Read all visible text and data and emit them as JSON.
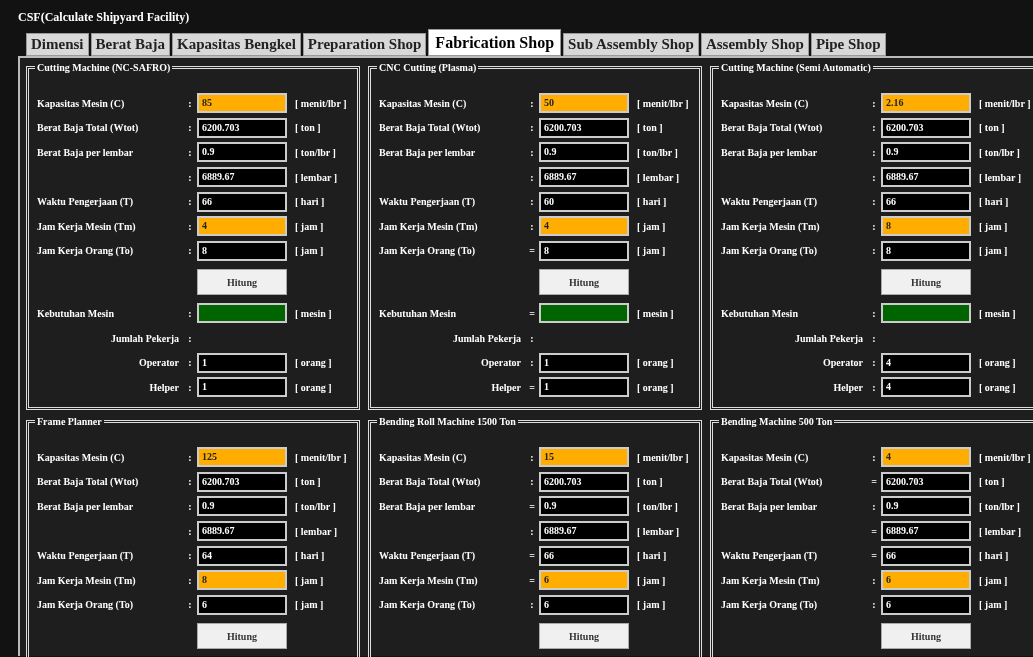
{
  "window": {
    "title": "CSF(Calculate Shipyard Facility)"
  },
  "tabs": [
    {
      "label": "Dimensi",
      "selected": false
    },
    {
      "label": "Berat Baja",
      "selected": false
    },
    {
      "label": "Kapasitas Bengkel",
      "selected": false
    },
    {
      "label": "Preparation Shop",
      "selected": false
    },
    {
      "label": "Fabrication Shop",
      "selected": true
    },
    {
      "label": "Sub Assembly Shop",
      "selected": false
    },
    {
      "label": "Assembly Shop",
      "selected": false
    },
    {
      "label": "Pipe Shop",
      "selected": false
    }
  ],
  "panels": [
    {
      "title": "Cutting Machine (NC-SAFRO)",
      "rows": [
        {
          "kind": "field",
          "label": "Kapasitas Mesin (C)",
          "separator": ":",
          "value": "85",
          "highlighted": true,
          "unit": "[ menit/lbr ]"
        },
        {
          "kind": "field",
          "label": "Berat Baja  Total (Wtot)",
          "separator": ":",
          "value": "6200.703",
          "highlighted": false,
          "unit": "[ ton ]"
        },
        {
          "kind": "field",
          "label": "Berat Baja per lembar",
          "separator": ":",
          "value": "0.9",
          "highlighted": false,
          "unit": "[ ton/lbr ]"
        },
        {
          "kind": "field",
          "separator": ":",
          "value": "6889.67",
          "highlighted": false,
          "unit": "[ lembar ]"
        },
        {
          "kind": "field",
          "label": "Waktu Pengerjaan (T)",
          "separator": ":",
          "value": "66",
          "highlighted": false,
          "unit": "[ hari ]"
        },
        {
          "kind": "field",
          "label": "Jam Kerja Mesin (Tm)",
          "separator": ":",
          "value": "4",
          "highlighted": true,
          "unit": "[ jam ]"
        },
        {
          "kind": "field",
          "label": "Jam Kerja Orang (To)",
          "separator": ":",
          "value": "8",
          "highlighted": false,
          "unit": "[ jam ]"
        },
        {
          "kind": "button",
          "label": "Hitung"
        },
        {
          "kind": "result",
          "label": "Kebutuhan Mesin",
          "separator": ":",
          "unit": "[ mesin ]"
        },
        {
          "kind": "group",
          "label": "Jumlah Pekerja",
          "separator": ":"
        },
        {
          "kind": "subfield",
          "label": "Operator",
          "separator": ":",
          "value": "1",
          "highlighted": false,
          "unit": "[ orang ]"
        },
        {
          "kind": "subfield",
          "label": "Helper",
          "separator": ":",
          "value": "1",
          "highlighted": false,
          "unit": "[ orang ]"
        }
      ]
    },
    {
      "title": "CNC Cutting (Plasma)",
      "rows": [
        {
          "kind": "field",
          "label": "Kapasitas Mesin (C)",
          "separator": ":",
          "value": "50",
          "highlighted": true,
          "unit": "[ menit/lbr ]"
        },
        {
          "kind": "field",
          "label": "Berat Baja  Total (Wtot)",
          "separator": ":",
          "value": "6200.703",
          "highlighted": false,
          "unit": "[ ton ]"
        },
        {
          "kind": "field",
          "label": "Berat Baja per lembar",
          "separator": ":",
          "value": "0.9",
          "highlighted": false,
          "unit": "[ ton/lbr ]"
        },
        {
          "kind": "field",
          "separator": ":",
          "value": "6889.67",
          "highlighted": false,
          "unit": "[ lembar ]"
        },
        {
          "kind": "field",
          "label": "Waktu Pengerjaan (T)",
          "separator": ":",
          "value": "60",
          "highlighted": false,
          "unit": "[ hari ]"
        },
        {
          "kind": "field",
          "label": "Jam Kerja Mesin (Tm)",
          "separator": ":",
          "value": "4",
          "highlighted": true,
          "unit": "[ jam ]"
        },
        {
          "kind": "field",
          "label": "Jam Kerja Orang (To)",
          "separator": "=",
          "value": "8",
          "highlighted": false,
          "unit": "[ jam ]"
        },
        {
          "kind": "button",
          "label": "Hitung"
        },
        {
          "kind": "result",
          "label": "Kebutuhan Mesin",
          "separator": "=",
          "unit": "[ mesin ]"
        },
        {
          "kind": "group",
          "label": "Jumlah Pekerja",
          "separator": ":"
        },
        {
          "kind": "subfield",
          "label": "Operator",
          "separator": ":",
          "value": "1",
          "highlighted": false,
          "unit": "[ orang ]"
        },
        {
          "kind": "subfield",
          "label": "Helper",
          "separator": "=",
          "value": "1",
          "highlighted": false,
          "unit": "[ orang ]"
        }
      ]
    },
    {
      "title": "Cutting Machine (Semi Automatic)",
      "rows": [
        {
          "kind": "field",
          "label": "Kapasitas Mesin (C)",
          "separator": ":",
          "value": "2.16",
          "highlighted": true,
          "unit": "[ menit/lbr ]"
        },
        {
          "kind": "field",
          "label": "Berat Baja  Total (Wtot)",
          "separator": ":",
          "value": "6200.703",
          "highlighted": false,
          "unit": "[ ton ]"
        },
        {
          "kind": "field",
          "label": "Berat Baja per lembar",
          "separator": ":",
          "value": "0.9",
          "highlighted": false,
          "unit": "[ ton/lbr ]"
        },
        {
          "kind": "field",
          "separator": ":",
          "value": "6889.67",
          "highlighted": false,
          "unit": "[ lembar ]"
        },
        {
          "kind": "field",
          "label": "Waktu Pengerjaan (T)",
          "separator": ":",
          "value": "66",
          "highlighted": false,
          "unit": "[ hari ]"
        },
        {
          "kind": "field",
          "label": "Jam Kerja Mesin (Tm)",
          "separator": ":",
          "value": "8",
          "highlighted": true,
          "unit": "[ jam ]"
        },
        {
          "kind": "field",
          "label": "Jam Kerja Orang (To)",
          "separator": ":",
          "value": "8",
          "highlighted": false,
          "unit": "[ jam ]"
        },
        {
          "kind": "button",
          "label": "Hitung"
        },
        {
          "kind": "result",
          "label": "Kebutuhan Mesin",
          "separator": ":",
          "unit": "[ mesin ]"
        },
        {
          "kind": "group",
          "label": "Jumlah Pekerja",
          "separator": ":"
        },
        {
          "kind": "subfield",
          "label": "Operator",
          "separator": ":",
          "value": "4",
          "highlighted": false,
          "unit": "[ orang ]"
        },
        {
          "kind": "subfield",
          "label": "Helper",
          "separator": ":",
          "value": "4",
          "highlighted": false,
          "unit": "[ orang ]"
        }
      ]
    },
    {
      "title": "Frame Planner",
      "rows": [
        {
          "kind": "field",
          "label": "Kapasitas Mesin (C)",
          "separator": ":",
          "value": "125",
          "highlighted": true,
          "unit": "[ menit/lbr ]"
        },
        {
          "kind": "field",
          "label": "Berat Baja  Total (Wtot)",
          "separator": ":",
          "value": "6200.703",
          "highlighted": false,
          "unit": "[ ton ]"
        },
        {
          "kind": "field",
          "label": "Berat Baja per lembar",
          "separator": ":",
          "value": "0.9",
          "highlighted": false,
          "unit": "[ ton/lbr ]"
        },
        {
          "kind": "field",
          "separator": ":",
          "value": "6889.67",
          "highlighted": false,
          "unit": "[ lembar ]"
        },
        {
          "kind": "field",
          "label": "Waktu Pengerjaan (T)",
          "separator": ":",
          "value": "64",
          "highlighted": false,
          "unit": "[ hari ]"
        },
        {
          "kind": "field",
          "label": "Jam Kerja Mesin (Tm)",
          "separator": ":",
          "value": "8",
          "highlighted": true,
          "unit": "[ jam ]"
        },
        {
          "kind": "field",
          "label": "Jam Kerja Orang (To)",
          "separator": ":",
          "value": "6",
          "highlighted": false,
          "unit": "[ jam ]"
        },
        {
          "kind": "button",
          "label": "Hitung"
        }
      ]
    },
    {
      "title": "Bending Roll Machine 1500 Ton",
      "rows": [
        {
          "kind": "field",
          "label": "Kapasitas Mesin (C)",
          "separator": ":",
          "value": "15",
          "highlighted": true,
          "unit": "[ menit/lbr ]"
        },
        {
          "kind": "field",
          "label": "Berat Baja  Total (Wtot)",
          "separator": ":",
          "value": "6200.703",
          "highlighted": false,
          "unit": "[ ton ]"
        },
        {
          "kind": "field",
          "label": "Berat Baja per lembar",
          "separator": "=",
          "value": "0.9",
          "highlighted": false,
          "unit": "[ ton/lbr ]"
        },
        {
          "kind": "field",
          "separator": ":",
          "value": "6889.67",
          "highlighted": false,
          "unit": "[ lembar ]"
        },
        {
          "kind": "field",
          "label": "Waktu Pengerjaan (T)",
          "separator": "=",
          "value": "66",
          "highlighted": false,
          "unit": "[ hari ]"
        },
        {
          "kind": "field",
          "label": "Jam Kerja Mesin (Tm)",
          "separator": "=",
          "value": "6",
          "highlighted": true,
          "unit": "[ jam ]"
        },
        {
          "kind": "field",
          "label": "Jam Kerja Orang (To)",
          "separator": ":",
          "value": "6",
          "highlighted": false,
          "unit": "[ jam ]"
        },
        {
          "kind": "button",
          "label": "Hitung"
        }
      ]
    },
    {
      "title": "Bending Machine 500 Ton",
      "rows": [
        {
          "kind": "field",
          "label": "Kapasitas Mesin (C)",
          "separator": ":",
          "value": "4",
          "highlighted": true,
          "unit": "[ menit/lbr ]"
        },
        {
          "kind": "field",
          "label": "Berat Baja  Total (Wtot)",
          "separator": "=",
          "value": "6200.703",
          "highlighted": false,
          "unit": "[ ton ]"
        },
        {
          "kind": "field",
          "label": "Berat Baja per lembar",
          "separator": ":",
          "value": "0.9",
          "highlighted": false,
          "unit": "[ ton/lbr ]"
        },
        {
          "kind": "field",
          "separator": "=",
          "value": "6889.67",
          "highlighted": false,
          "unit": "[ lembar ]"
        },
        {
          "kind": "field",
          "label": "Waktu Pengerjaan (T)",
          "separator": "=",
          "value": "66",
          "highlighted": false,
          "unit": "[ hari ]"
        },
        {
          "kind": "field",
          "label": "Jam Kerja Mesin (Tm)",
          "separator": ":",
          "value": "6",
          "highlighted": true,
          "unit": "[ jam ]"
        },
        {
          "kind": "field",
          "label": "Jam Kerja Orang (To)",
          "separator": ":",
          "value": "6",
          "highlighted": false,
          "unit": "[ jam ]"
        },
        {
          "kind": "button",
          "label": "Hitung"
        }
      ]
    }
  ]
}
